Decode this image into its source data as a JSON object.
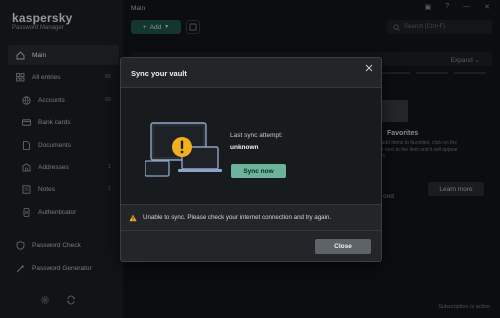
{
  "brand": {
    "name": "kaspersky",
    "subtitle": "Password Manager"
  },
  "sidebar": {
    "items": [
      {
        "label": "Main",
        "count": "",
        "icon": "home-icon",
        "active": true
      },
      {
        "label": "All entries",
        "count": "65",
        "icon": "grid-icon"
      },
      {
        "label": "Accounts",
        "count": "65",
        "icon": "globe-icon"
      },
      {
        "label": "Bank cards",
        "count": "",
        "icon": "card-icon"
      },
      {
        "label": "Documents",
        "count": "",
        "icon": "document-icon"
      },
      {
        "label": "Addresses",
        "count": "1",
        "icon": "address-icon"
      },
      {
        "label": "Notes",
        "count": "1",
        "icon": "note-icon"
      },
      {
        "label": "Authenticator",
        "count": "",
        "icon": "authenticator-icon"
      },
      {
        "label": "Password Check",
        "count": "",
        "icon": "shield-icon"
      },
      {
        "label": "Password Generator",
        "count": "",
        "icon": "wand-icon"
      }
    ]
  },
  "main": {
    "title": "Main",
    "add_label": "Add",
    "search_placeholder": "Search (Ctrl+F)",
    "expand_label": "Expand",
    "favorites_title": "Favorites",
    "favorites_desc": "To add items to favorites, click on the star next to the item and it will appear here.",
    "learn_more": "Learn more",
    "peek_text": "ond",
    "subscription_status": "Subscription is active"
  },
  "dialog": {
    "title": "Sync your vault",
    "last_sync_label": "Last sync attempt:",
    "last_sync_value": "unknown",
    "sync_button": "Sync now",
    "warning": "Unable to sync. Please check your internet connection and try again.",
    "close_button": "Close"
  },
  "colors": {
    "accent_green": "#6bb39a",
    "warning_yellow": "#f2b01e",
    "dialog_bg": "#222629"
  }
}
